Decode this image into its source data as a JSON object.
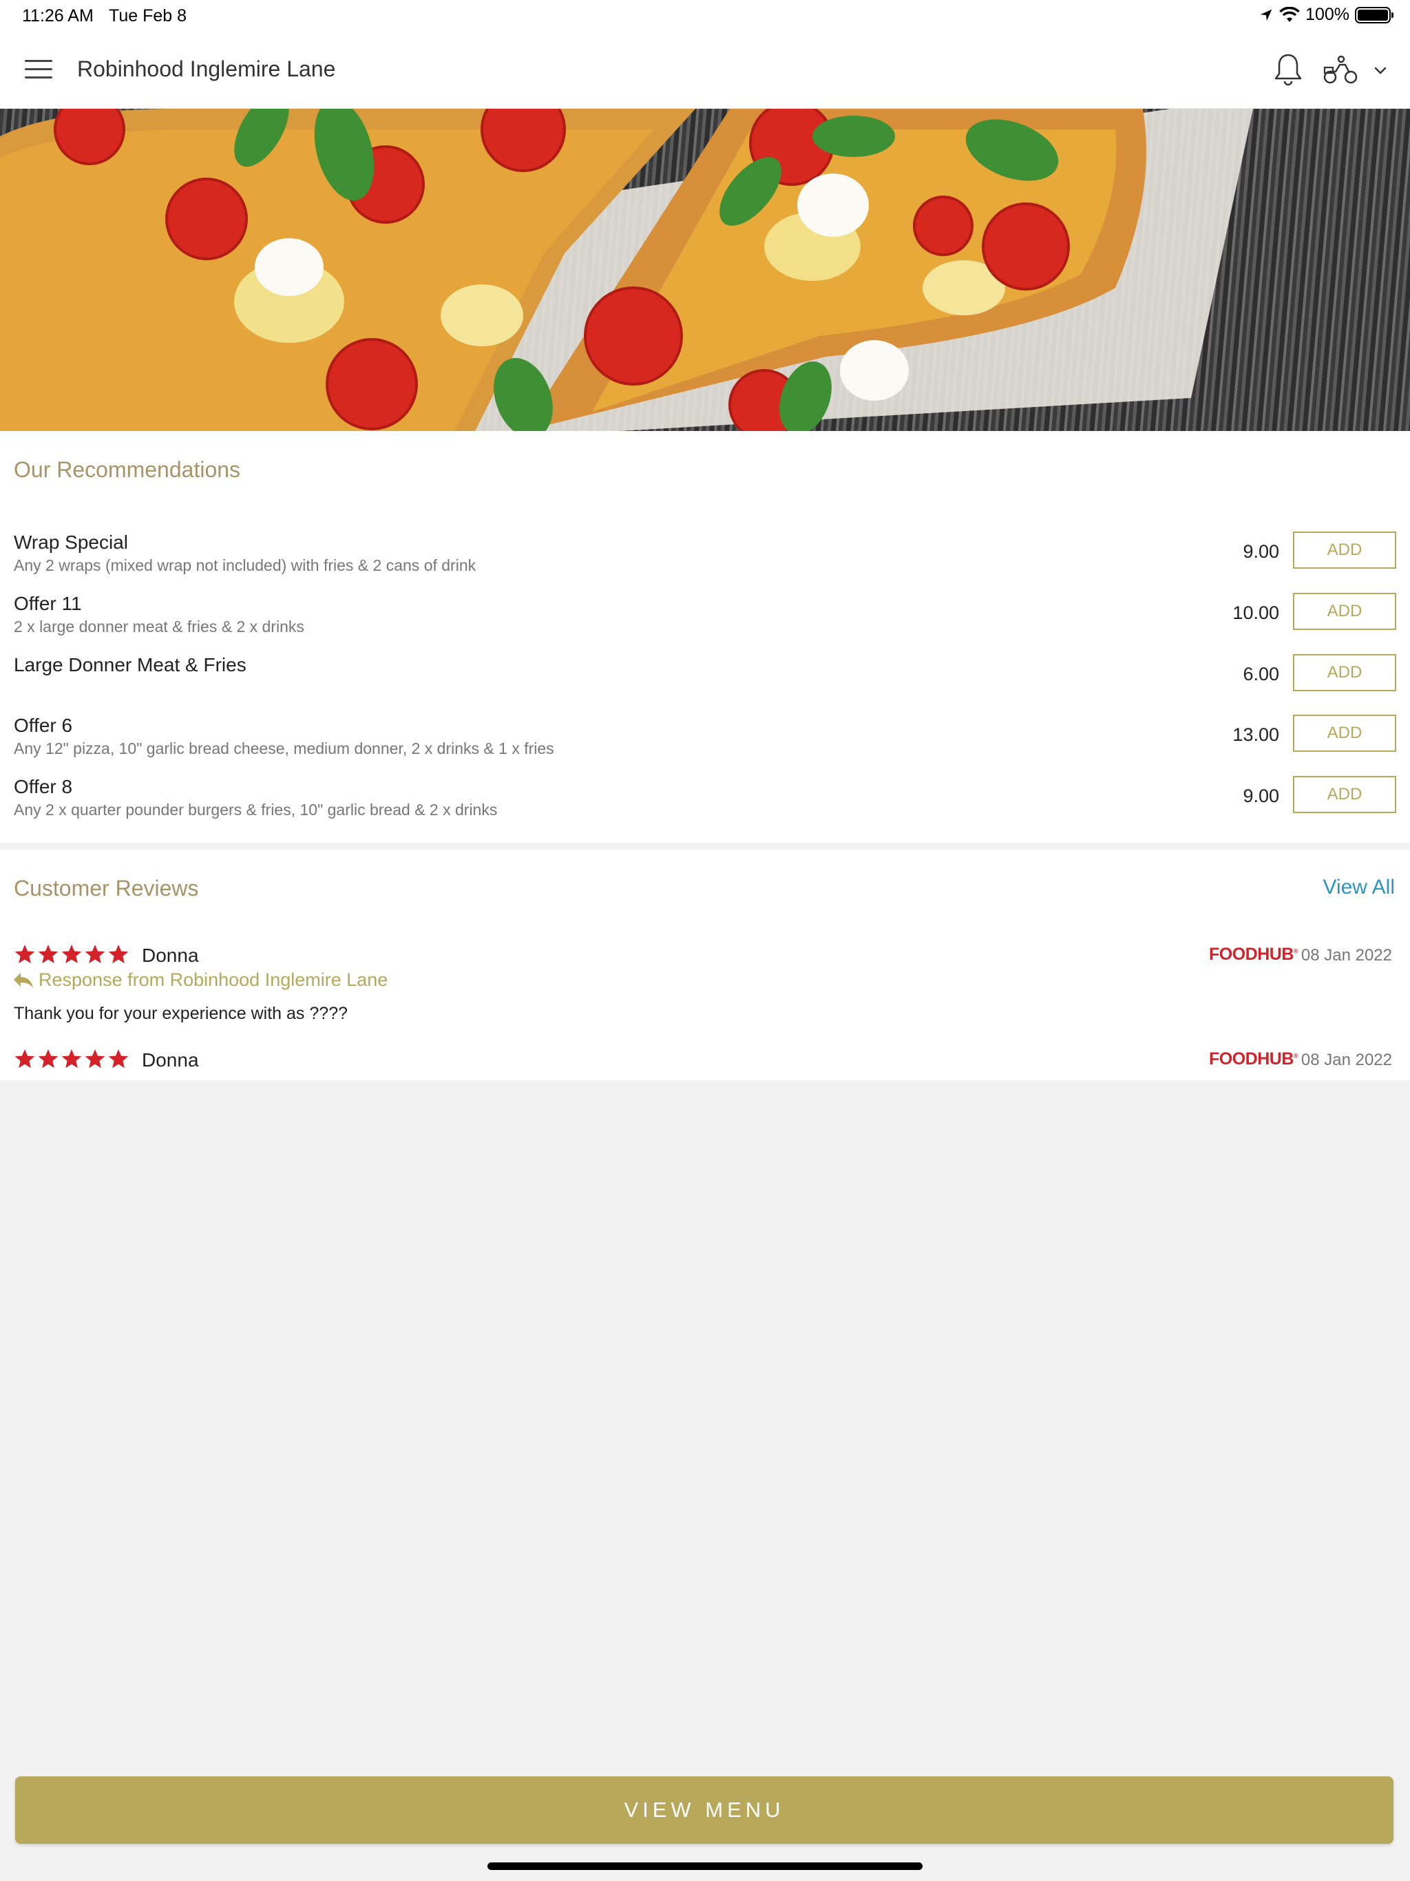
{
  "status_bar": {
    "time": "11:26 AM",
    "date": "Tue Feb 8",
    "battery": "100%"
  },
  "header": {
    "title": "Robinhood Inglemire Lane"
  },
  "hero": {
    "image": "pizza-photo"
  },
  "recommendations": {
    "title": "Our Recommendations",
    "add_label": "ADD",
    "items": [
      {
        "name": "Wrap Special",
        "description": "Any 2 wraps (mixed wrap not included) with fries & 2 cans of drink",
        "price": "9.00"
      },
      {
        "name": "Offer 11",
        "description": "2 x large donner meat & fries & 2 x drinks",
        "price": "10.00"
      },
      {
        "name": "Large Donner Meat & Fries",
        "description": "",
        "price": "6.00"
      },
      {
        "name": "Offer 6",
        "description": "Any 12\" pizza, 10\" garlic bread cheese, medium donner, 2 x drinks & 1 x fries",
        "price": "13.00"
      },
      {
        "name": "Offer 8",
        "description": "Any 2 x quarter pounder burgers & fries, 10\" garlic bread & 2 x drinks",
        "price": "9.00"
      }
    ]
  },
  "reviews": {
    "title": "Customer Reviews",
    "view_all": "View All",
    "items": [
      {
        "rating": 5,
        "name": "Donna",
        "source": "FOODHUB",
        "date": "08 Jan 2022",
        "response_label": "Response from Robinhood Inglemire Lane",
        "response_text": "Thank you for your experience with as ????"
      },
      {
        "rating": 5,
        "name": "Donna",
        "source": "FOODHUB",
        "date": "08 Jan 2022"
      }
    ]
  },
  "footer": {
    "view_menu": "VIEW MENU"
  },
  "colors": {
    "accent": "#b8a85a",
    "title_gold": "#a89468",
    "link": "#2a95c6",
    "star": "#d3222a",
    "foodhub_red": "#d3222a"
  }
}
